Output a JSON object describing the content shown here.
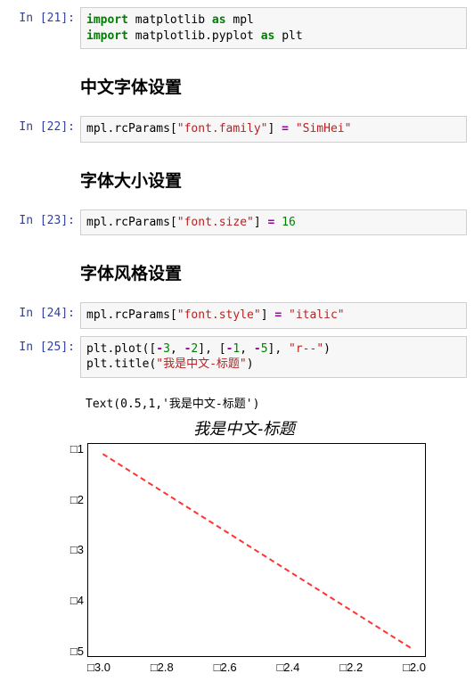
{
  "cells": {
    "c21": {
      "prompt": "In [21]:",
      "code_html": "<span class=\"kw\">import</span> <span class=\"id\">matplotlib</span> <span class=\"kw\">as</span> <span class=\"id\">mpl</span>\n<span class=\"kw\">import</span> <span class=\"id\">matplotlib</span>.<span class=\"id\">pyplot</span> <span class=\"kw\">as</span> <span class=\"id\">plt</span>"
    },
    "h1": "中文字体设置",
    "c22": {
      "prompt": "In [22]:",
      "code_html": "<span class=\"id\">mpl</span>.<span class=\"id\">rcParams</span>[<span class=\"str\">\"font.family\"</span>] <span class=\"op\">=</span> <span class=\"str\">\"SimHei\"</span>"
    },
    "h2": "字体大小设置",
    "c23": {
      "prompt": "In [23]:",
      "code_html": "<span class=\"id\">mpl</span>.<span class=\"id\">rcParams</span>[<span class=\"str\">\"font.size\"</span>] <span class=\"op\">=</span> <span class=\"num\">16</span>"
    },
    "h3": "字体风格设置",
    "c24": {
      "prompt": "In [24]:",
      "code_html": "<span class=\"id\">mpl</span>.<span class=\"id\">rcParams</span>[<span class=\"str\">\"font.style\"</span>] <span class=\"op\">=</span> <span class=\"str\">\"italic\"</span>"
    },
    "c25": {
      "prompt": "In [25]:",
      "code_html": "<span class=\"id\">plt</span>.<span class=\"id\">plot</span>([<span class=\"op\">-</span><span class=\"num\">3</span>, <span class=\"op\">-</span><span class=\"num\">2</span>], [<span class=\"op\">-</span><span class=\"num\">1</span>, <span class=\"op\">-</span><span class=\"num\">5</span>], <span class=\"str\">\"r--\"</span>)\n<span class=\"id\">plt</span>.<span class=\"id\">title</span>(<span class=\"str\">\"我是中文-标题\"</span>)",
      "output_text": "Text(0.5,1,'我是中文-标题')"
    }
  },
  "chart_data": {
    "type": "line",
    "title": "我是中文-标题",
    "series": [
      {
        "name": "r--",
        "x": [
          -3,
          -2
        ],
        "y": [
          -1,
          -5
        ],
        "style": "red dashed"
      }
    ],
    "xticks": [
      "□3.0",
      "□2.8",
      "□2.6",
      "□2.4",
      "□2.2",
      "□2.0"
    ],
    "yticks": [
      "□1",
      "□2",
      "□3",
      "□4",
      "□5"
    ],
    "xlim": [
      -3.0,
      -2.0
    ],
    "ylim": [
      -5,
      -1
    ],
    "grid": false
  }
}
